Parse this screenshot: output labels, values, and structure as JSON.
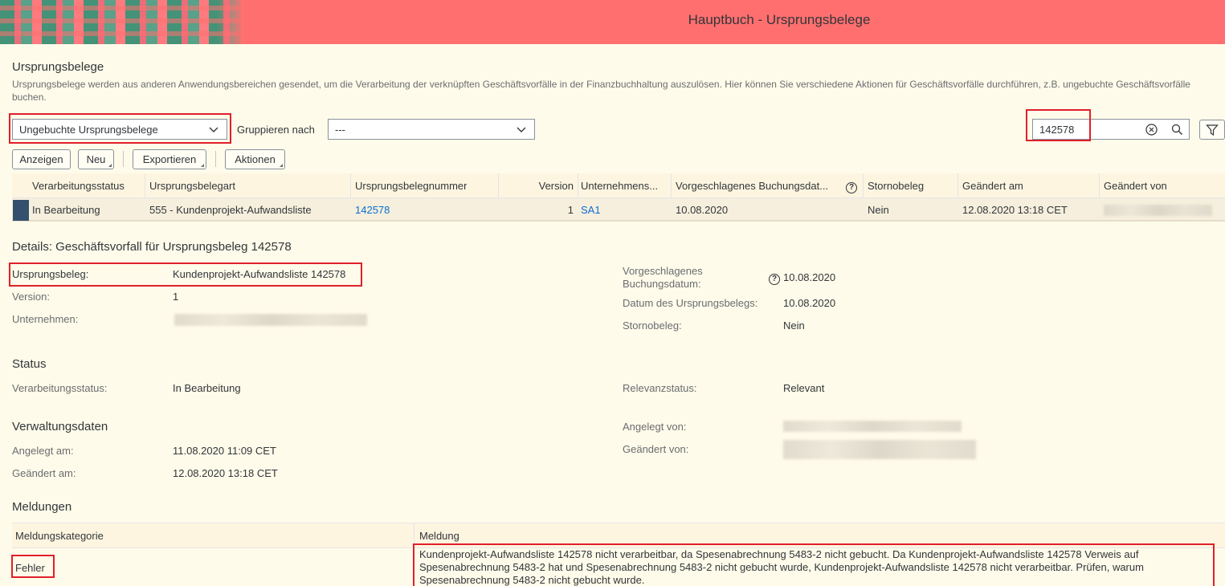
{
  "shell": {
    "title": "Hauptbuch - Ursprungsbelege"
  },
  "page": {
    "heading": "Ursprungsbelege",
    "description": "Ursprungsbelege werden aus anderen Anwendungsbereichen gesendet, um die Verarbeitung der verknüpften Geschäftsvorfälle in der Finanzbuchhaltung auszulösen. Hier können Sie verschiedene Aktionen für Geschäftsvorfälle durchführen, z.B. ungebuchte Geschäftsvorfälle buchen."
  },
  "filterbar": {
    "view_select": "Ungebuchte Ursprungsbelege",
    "group_label": "Gruppieren nach",
    "group_select": "---",
    "search_value": "142578"
  },
  "toolbar": {
    "show": "Anzeigen",
    "new": "Neu",
    "export": "Exportieren",
    "actions": "Aktionen"
  },
  "table": {
    "headers": [
      "Verarbeitungsstatus",
      "Ursprungsbelegart",
      "Ursprungsbelegnummer",
      "Version",
      "Unternehmens...",
      "Vorgeschlagenes Buchungsdat...",
      "Stornobeleg",
      "Geändert am",
      "Geändert von"
    ],
    "rows": [
      {
        "status": "In Bearbeitung",
        "type": "555 - Kundenprojekt-Aufwandsliste",
        "number": "142578",
        "version": "1",
        "company": "SA1",
        "posting_date": "10.08.2020",
        "reversal": "Nein",
        "changed_on": "12.08.2020 13:18 CET"
      }
    ]
  },
  "details": {
    "heading": "Details: Geschäftsvorfall für Ursprungsbeleg 142578",
    "source_doc_label": "Ursprungsbeleg:",
    "source_doc_value": "Kundenprojekt-Aufwandsliste 142578",
    "version_label": "Version:",
    "version_value": "1",
    "company_label": "Unternehmen:",
    "posting_date_label": "Vorgeschlagenes Buchungsdatum:",
    "posting_date_value": "10.08.2020",
    "doc_date_label": "Datum des Ursprungsbelegs:",
    "doc_date_value": "10.08.2020",
    "reversal_label": "Stornobeleg:",
    "reversal_value": "Nein"
  },
  "status": {
    "heading": "Status",
    "proc_label": "Verarbeitungsstatus:",
    "proc_value": "In Bearbeitung",
    "relevance_label": "Relevanzstatus:",
    "relevance_value": "Relevant"
  },
  "admin": {
    "heading": "Verwaltungsdaten",
    "created_on_label": "Angelegt am:",
    "created_on_value": "11.08.2020 11:09 CET",
    "changed_on_label": "Geändert am:",
    "changed_on_value": "12.08.2020 13:18 CET",
    "created_by_label": "Angelegt von:",
    "changed_by_label": "Geändert von:"
  },
  "messages": {
    "heading": "Meldungen",
    "col_category": "Meldungskategorie",
    "col_message": "Meldung",
    "row_category": "Fehler",
    "row_message": "Kundenprojekt-Aufwandsliste 142578 nicht verarbeitbar, da Spesenabrechnung 5483-2 nicht gebucht. Da Kundenprojekt-Aufwandsliste 142578 Verweis auf Spesenabrechnung 5483-2 hat und Spesenabrechnung 5483-2 nicht gebucht wurde, Kundenprojekt-Aufwandsliste 142578 nicht verarbeitbar. Prüfen, warum Spesenabrechnung 5483-2 nicht gebucht wurde."
  }
}
